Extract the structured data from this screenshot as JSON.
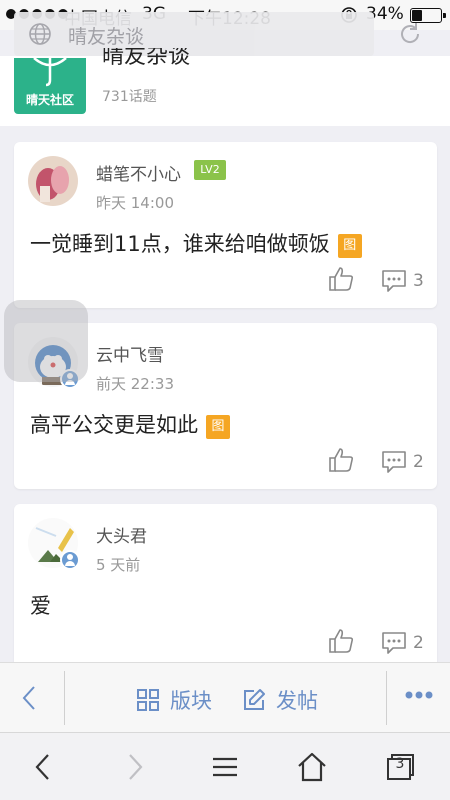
{
  "status_bar": {
    "carrier": "中国电信",
    "network": "3G",
    "time": "下午12:28",
    "battery_percent_text": "34%",
    "battery_level": 0.34
  },
  "browser": {
    "address_text": "晴友杂谈"
  },
  "forum": {
    "logo_caption": "晴天社区",
    "title": "晴友杂谈",
    "topic_count": "731话题"
  },
  "posts": [
    {
      "author": "蜡笔不小心",
      "level": "LV2",
      "date": "昨天 14:00",
      "content": "一觉睡到11点，谁来给咱做顿饭",
      "image_badge": "图",
      "comments": "3"
    },
    {
      "author": "云中飞雪",
      "date": "前天 22:33",
      "content": "高平公交更是如此",
      "image_badge": "图",
      "comments": "2"
    },
    {
      "author": "大头君",
      "date": "5 天前",
      "content": "爱",
      "comments": "2"
    }
  ],
  "toolbar": {
    "board_label": "版块",
    "post_label": "发帖"
  },
  "browser_nav": {
    "tab_count": "3"
  },
  "colors": {
    "accent_blue": "#6b8fc7",
    "level_green": "#8bc34a",
    "image_badge_orange": "#f5a623",
    "logo_green": "#2cb28a"
  }
}
